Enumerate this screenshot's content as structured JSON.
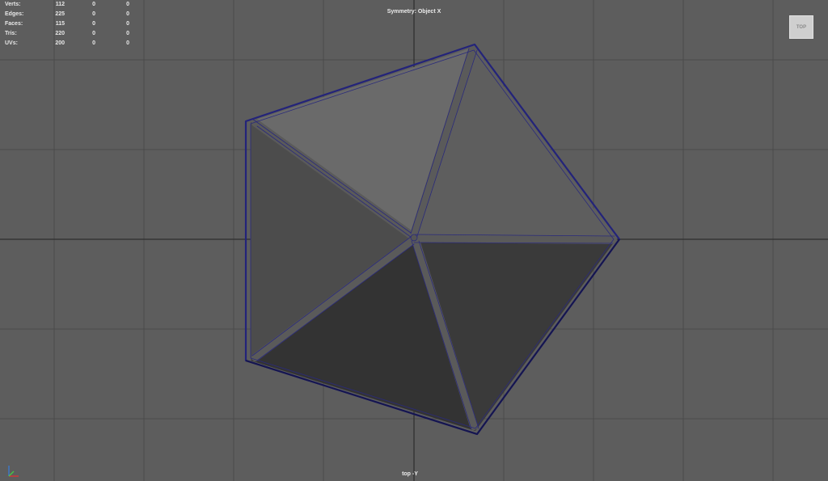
{
  "hud": {
    "rows": [
      {
        "label": "Verts:",
        "v1": "112",
        "v2": "0",
        "v3": "0"
      },
      {
        "label": "Edges:",
        "v1": "225",
        "v2": "0",
        "v3": "0"
      },
      {
        "label": "Faces:",
        "v1": "115",
        "v2": "0",
        "v3": "0"
      },
      {
        "label": "Tris:",
        "v1": "220",
        "v2": "0",
        "v3": "0"
      },
      {
        "label": "UVs:",
        "v1": "200",
        "v2": "0",
        "v3": "0"
      }
    ]
  },
  "symmetry_label": "Symmetry: Object X",
  "camera_label": "top -Y",
  "viewcube_label": "TOP",
  "colors": {
    "background": "#5d5d5d",
    "grid": "#4a4a4a",
    "grid_axis": "#2e2e2e",
    "wireframe": "#2a2a7c",
    "face_light_top": "#6c6c6c",
    "face_light_right": "#5f5f5f",
    "face_left": "#4d4d4d",
    "face_dark_bottom": "#333333",
    "face_dark_right": "#3b3b3b"
  },
  "icons": [
    "axis-gizmo-icon"
  ]
}
